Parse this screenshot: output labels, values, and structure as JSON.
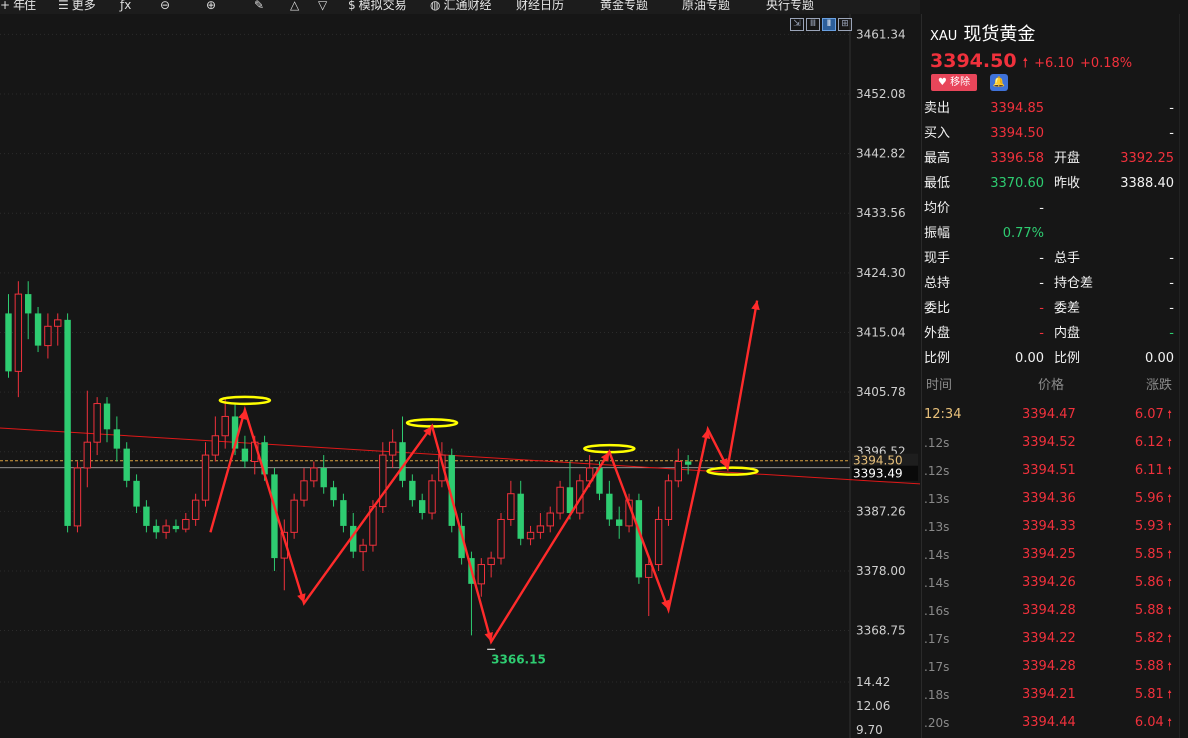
{
  "toolbar": {
    "items": [
      {
        "icon": "cross-icon",
        "label": "年",
        "x": 0
      },
      {
        "icon": "",
        "label": "住",
        "x": 24
      },
      {
        "icon": "menu-icon",
        "label": "更多",
        "x": 58
      },
      {
        "icon": "fx-icon",
        "label": "",
        "x": 120
      },
      {
        "icon": "zoom-out-icon",
        "label": "",
        "x": 160
      },
      {
        "icon": "zoom-in-icon",
        "label": "",
        "x": 206
      },
      {
        "icon": "pen-icon",
        "label": "",
        "x": 254
      },
      {
        "icon": "triangle-icon",
        "label": "",
        "x": 290
      },
      {
        "icon": "dropdown-icon",
        "label": "",
        "x": 318
      },
      {
        "icon": "dollar-icon",
        "label": "模拟交易",
        "x": 348
      },
      {
        "icon": "globe-icon",
        "label": "汇通财经",
        "x": 430
      },
      {
        "icon": "",
        "label": "财经日历",
        "x": 516
      },
      {
        "icon": "",
        "label": "黄金专题",
        "x": 600
      },
      {
        "icon": "",
        "label": "原油专题",
        "x": 682
      },
      {
        "icon": "",
        "label": "央行专题",
        "x": 766
      }
    ]
  },
  "quote": {
    "code": "XAU",
    "name": "现货黄金",
    "price": "3394.50",
    "change": "+6.10",
    "change_pct": "+0.18%",
    "remove_label": "移除",
    "fields": [
      {
        "l1": "卖出",
        "v1": "3394.85",
        "c1": "red",
        "l2": "",
        "v2": "-",
        "c2": "white"
      },
      {
        "l1": "买入",
        "v1": "3394.50",
        "c1": "red",
        "l2": "",
        "v2": "-",
        "c2": "white"
      },
      {
        "l1": "最高",
        "v1": "3396.58",
        "c1": "red",
        "l2": "开盘",
        "v2": "3392.25",
        "c2": "red"
      },
      {
        "l1": "最低",
        "v1": "3370.60",
        "c1": "green",
        "l2": "昨收",
        "v2": "3388.40",
        "c2": "white"
      },
      {
        "l1": "均价",
        "v1": "-",
        "c1": "white",
        "l2": "",
        "v2": "",
        "c2": "white"
      },
      {
        "l1": "振幅",
        "v1": "0.77%",
        "c1": "green",
        "l2": "",
        "v2": "",
        "c2": "white"
      },
      {
        "l1": "现手",
        "v1": "-",
        "c1": "white",
        "l2": "总手",
        "v2": "-",
        "c2": "white"
      },
      {
        "l1": "总持",
        "v1": "-",
        "c1": "white",
        "l2": "持仓差",
        "v2": "-",
        "c2": "white"
      },
      {
        "l1": "委比",
        "v1": "-",
        "c1": "red",
        "l2": "委差",
        "v2": "-",
        "c2": "white"
      },
      {
        "l1": "外盘",
        "v1": "-",
        "c1": "red",
        "l2": "内盘",
        "v2": "-",
        "c2": "green"
      },
      {
        "l1": "比例",
        "v1": "0.00",
        "c1": "white",
        "l2": "比例",
        "v2": "0.00",
        "c2": "white"
      }
    ],
    "ticks_header": {
      "time": "时间",
      "price": "价格",
      "change": "涨跌"
    },
    "ticks": [
      {
        "time": "12:34",
        "price": "3394.47",
        "change": "6.07"
      },
      {
        "time": ".12s",
        "price": "3394.52",
        "change": "6.12"
      },
      {
        "time": ".12s",
        "price": "3394.51",
        "change": "6.11"
      },
      {
        "time": ".13s",
        "price": "3394.36",
        "change": "5.96"
      },
      {
        "time": ".13s",
        "price": "3394.33",
        "change": "5.93"
      },
      {
        "time": ".14s",
        "price": "3394.25",
        "change": "5.85"
      },
      {
        "time": ".14s",
        "price": "3394.26",
        "change": "5.86"
      },
      {
        "time": ".16s",
        "price": "3394.28",
        "change": "5.88"
      },
      {
        "time": ".17s",
        "price": "3394.22",
        "change": "5.82"
      },
      {
        "time": ".17s",
        "price": "3394.28",
        "change": "5.88"
      },
      {
        "time": ".18s",
        "price": "3394.21",
        "change": "5.81"
      },
      {
        "time": ".20s",
        "price": "3394.44",
        "change": "6.04"
      }
    ]
  },
  "chart_data": {
    "type": "candlestick",
    "y_ticks": [
      "3461.34",
      "3452.08",
      "3442.82",
      "3433.56",
      "3424.30",
      "3415.04",
      "3405.78",
      "3396.52",
      "3387.26",
      "3378.00",
      "3368.75"
    ],
    "volume_ticks": [
      "14.42",
      "12.06",
      "9.70"
    ],
    "ylim": [
      3362.0,
      3464.5
    ],
    "last_price_label": "3394.50",
    "cursor_price_label": "3393.49",
    "low_label": "3366.15",
    "colors": {
      "up": "#f0313c",
      "down": "#2ecc71",
      "trendline": "#e01818",
      "annotation": "#ff2b2b",
      "highlight": "#ffff00"
    },
    "candles": [
      [
        3418.0,
        3421.0,
        3408.0,
        3409.0
      ],
      [
        3409.0,
        3423.0,
        3405.0,
        3421.0
      ],
      [
        3421.0,
        3423.0,
        3414.0,
        3418.0
      ],
      [
        3418.0,
        3419.0,
        3412.0,
        3413.0
      ],
      [
        3413.0,
        3418.0,
        3411.0,
        3416.0
      ],
      [
        3416.0,
        3418.0,
        3413.0,
        3417.0
      ],
      [
        3417.0,
        3418.0,
        3384.0,
        3385.0
      ],
      [
        3385.0,
        3395.0,
        3384.0,
        3394.0
      ],
      [
        3394.0,
        3406.0,
        3391.0,
        3398.0
      ],
      [
        3398.0,
        3405.0,
        3396.0,
        3404.0
      ],
      [
        3404.0,
        3405.0,
        3398.0,
        3400.0
      ],
      [
        3400.0,
        3402.0,
        3395.0,
        3397.0
      ],
      [
        3397.0,
        3398.0,
        3391.0,
        3392.0
      ],
      [
        3392.0,
        3393.0,
        3387.0,
        3388.0
      ],
      [
        3388.0,
        3389.0,
        3384.0,
        3385.0
      ],
      [
        3385.0,
        3386.0,
        3383.0,
        3384.0
      ],
      [
        3384.0,
        3386.0,
        3383.0,
        3385.0
      ],
      [
        3385.0,
        3386.0,
        3384.0,
        3384.5
      ],
      [
        3384.5,
        3387.0,
        3384.0,
        3386.0
      ],
      [
        3386.0,
        3390.0,
        3385.0,
        3389.0
      ],
      [
        3389.0,
        3398.0,
        3388.0,
        3396.0
      ],
      [
        3396.0,
        3402.0,
        3395.0,
        3399.0
      ],
      [
        3399.0,
        3405.0,
        3397.0,
        3402.0
      ],
      [
        3402.0,
        3404.0,
        3396.0,
        3397.0
      ],
      [
        3397.0,
        3399.0,
        3394.0,
        3395.0
      ],
      [
        3395.0,
        3399.0,
        3393.0,
        3398.0
      ],
      [
        3398.0,
        3399.0,
        3392.0,
        3393.0
      ],
      [
        3393.0,
        3394.0,
        3378.0,
        3380.0
      ],
      [
        3380.0,
        3386.0,
        3375.0,
        3384.0
      ],
      [
        3384.0,
        3390.0,
        3383.0,
        3389.0
      ],
      [
        3389.0,
        3394.0,
        3388.0,
        3392.0
      ],
      [
        3392.0,
        3395.0,
        3391.0,
        3394.0
      ],
      [
        3394.0,
        3396.0,
        3390.0,
        3391.0
      ],
      [
        3391.0,
        3392.0,
        3388.0,
        3389.0
      ],
      [
        3389.0,
        3390.0,
        3384.0,
        3385.0
      ],
      [
        3385.0,
        3387.0,
        3380.0,
        3381.0
      ],
      [
        3381.0,
        3383.0,
        3378.0,
        3382.0
      ],
      [
        3382.0,
        3389.0,
        3381.0,
        3388.0
      ],
      [
        3388.0,
        3398.0,
        3387.0,
        3396.0
      ],
      [
        3396.0,
        3400.0,
        3394.0,
        3398.0
      ],
      [
        3398.0,
        3402.0,
        3391.0,
        3392.0
      ],
      [
        3392.0,
        3393.0,
        3388.0,
        3389.0
      ],
      [
        3389.0,
        3390.0,
        3386.0,
        3387.0
      ],
      [
        3387.0,
        3393.0,
        3386.0,
        3392.0
      ],
      [
        3392.0,
        3398.0,
        3391.0,
        3396.0
      ],
      [
        3396.0,
        3397.0,
        3384.0,
        3385.0
      ],
      [
        3385.0,
        3387.0,
        3379.0,
        3380.0
      ],
      [
        3380.0,
        3381.0,
        3368.0,
        3376.0
      ],
      [
        3376.0,
        3380.0,
        3374.0,
        3379.0
      ],
      [
        3379.0,
        3381.0,
        3377.0,
        3380.0
      ],
      [
        3380.0,
        3387.0,
        3379.0,
        3386.0
      ],
      [
        3386.0,
        3392.0,
        3385.0,
        3390.0
      ],
      [
        3390.0,
        3392.0,
        3382.0,
        3383.0
      ],
      [
        3383.0,
        3385.0,
        3382.0,
        3384.0
      ],
      [
        3384.0,
        3387.0,
        3383.0,
        3385.0
      ],
      [
        3385.0,
        3388.0,
        3384.0,
        3387.0
      ],
      [
        3387.0,
        3392.0,
        3386.0,
        3391.0
      ],
      [
        3391.0,
        3395.0,
        3386.0,
        3387.0
      ],
      [
        3387.0,
        3393.0,
        3386.0,
        3392.0
      ],
      [
        3392.0,
        3396.0,
        3391.0,
        3394.0
      ],
      [
        3394.0,
        3395.0,
        3389.0,
        3390.0
      ],
      [
        3390.0,
        3392.0,
        3385.0,
        3386.0
      ],
      [
        3386.0,
        3388.0,
        3383.0,
        3385.0
      ],
      [
        3385.0,
        3390.0,
        3384.0,
        3389.0
      ],
      [
        3389.0,
        3390.0,
        3376.0,
        3377.0
      ],
      [
        3377.0,
        3380.0,
        3371.0,
        3379.0
      ],
      [
        3379.0,
        3388.0,
        3378.0,
        3386.0
      ],
      [
        3386.0,
        3393.0,
        3385.0,
        3392.0
      ],
      [
        3392.0,
        3397.0,
        3391.0,
        3395.0
      ],
      [
        3395.0,
        3396.0,
        3393.0,
        3394.5
      ]
    ],
    "trendline": {
      "from": [
        -4,
        3400.5
      ],
      "to": [
        96,
        3391.2
      ]
    },
    "annotation_arrow_points": [
      [
        20.5,
        3384.0
      ],
      [
        24.0,
        3403.0
      ],
      [
        30.0,
        3373.0
      ],
      [
        43.0,
        3400.5
      ],
      [
        49.0,
        3367.0
      ],
      [
        61.0,
        3396.5
      ],
      [
        67.0,
        3372.0
      ],
      [
        71.0,
        3400.0
      ],
      [
        73.0,
        3394.0
      ],
      [
        76.0,
        3420.0
      ]
    ],
    "highlight_levels": [
      [
        24.0,
        3404.5
      ],
      [
        43.0,
        3401.0
      ],
      [
        61.0,
        3397.0
      ],
      [
        73.5,
        3393.5
      ]
    ]
  }
}
